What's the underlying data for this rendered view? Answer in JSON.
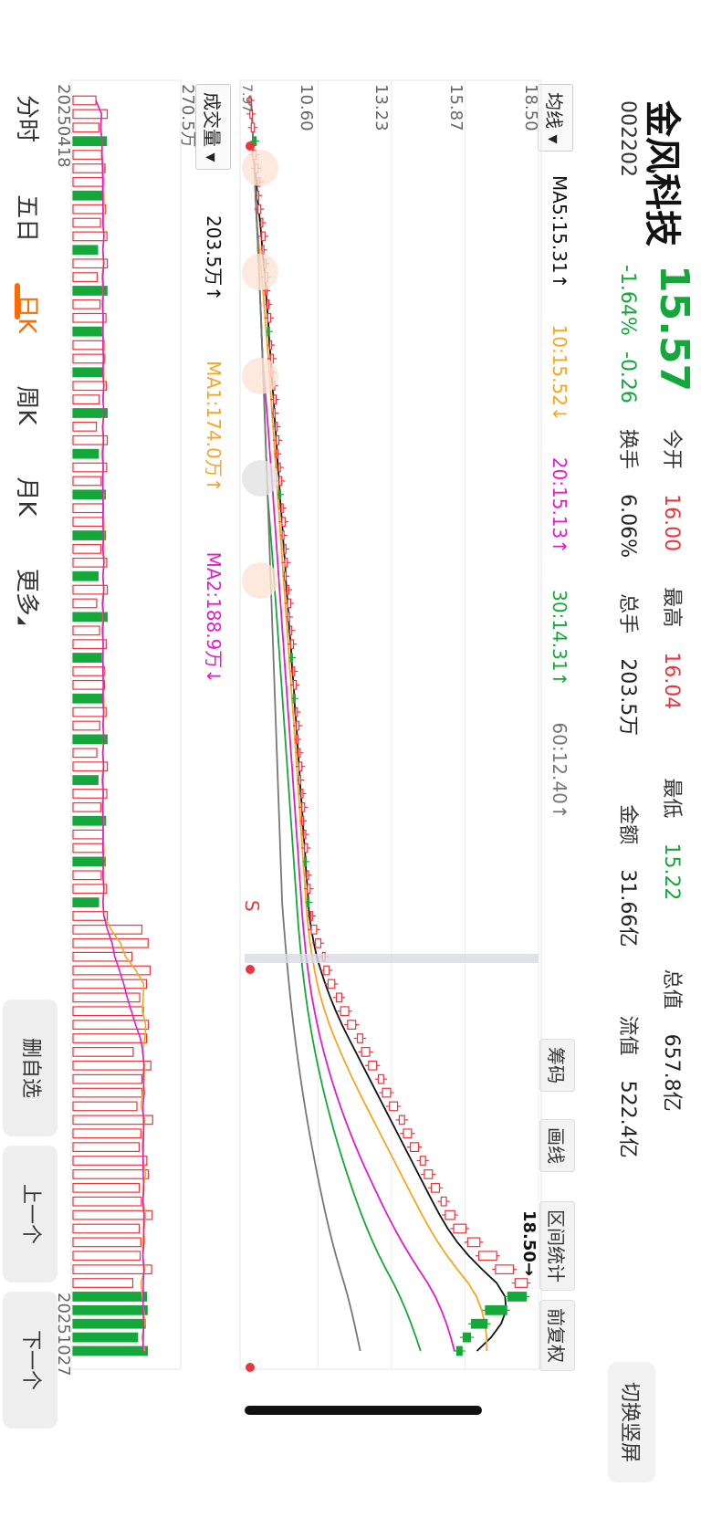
{
  "header": {
    "name": "金风科技",
    "price": "15.57",
    "code": "002202",
    "change_pct": "-1.64%",
    "change_abs": "-0.26",
    "stats": [
      {
        "label": "今开",
        "value": "16.00",
        "color": "#e8363c"
      },
      {
        "label": "最高",
        "value": "16.04",
        "color": "#e8363c"
      },
      {
        "label": "最低",
        "value": "15.22",
        "color": "#14a83a"
      },
      {
        "label": "总值",
        "value": "657.8亿",
        "color": "#222222"
      },
      {
        "label": "换手",
        "value": "6.06%",
        "color": "#222222"
      },
      {
        "label": "总手",
        "value": "203.5万",
        "color": "#222222"
      },
      {
        "label": "金额",
        "value": "31.66亿",
        "color": "#222222"
      },
      {
        "label": "流值",
        "value": "522.4亿",
        "color": "#222222"
      }
    ],
    "switch_label": "切换竖屏"
  },
  "ma_bar": {
    "selector": "均线",
    "items": [
      {
        "text": "MA5:15.31↑",
        "color": "#111111"
      },
      {
        "text": "10:15.52↓",
        "color": "#f5a623"
      },
      {
        "text": "20:15.13↑",
        "color": "#e01ec8"
      },
      {
        "text": "30:14.31↑",
        "color": "#14a83a"
      },
      {
        "text": "60:12.40↑",
        "color": "#777777"
      }
    ]
  },
  "tools": [
    "筹码",
    "画线",
    "区间统计",
    "前复权"
  ],
  "vol_bar": {
    "selector": "成交量",
    "items": [
      {
        "text": "203.5万↑",
        "color": "#111111"
      },
      {
        "text": "MA1:174.0万↑",
        "color": "#f5a623"
      },
      {
        "text": "MA2:188.9万↓",
        "color": "#e01ec8"
      }
    ]
  },
  "tabs": [
    "分时",
    "五日",
    "日K",
    "周K",
    "月K",
    "更多"
  ],
  "active_tab": "日K",
  "bottom_buttons": [
    "删自选",
    "上一个",
    "下一个"
  ],
  "markers": {
    "sell": "S",
    "max_label": "18.50→",
    "min_label": "7.97"
  },
  "chart_data": {
    "type": "candlestick",
    "price_axis": {
      "ticks": [
        "18.50",
        "15.87",
        "13.23",
        "10.60"
      ],
      "ylim": [
        7.97,
        18.5
      ]
    },
    "volume_axis": {
      "ticks": [
        "270.5万"
      ]
    },
    "x_start": "20250418",
    "x_end": "20251027",
    "max": 18.5,
    "min": 7.97,
    "series": [
      {
        "name": "MA5",
        "color": "#111111"
      },
      {
        "name": "10",
        "color": "#f5a623"
      },
      {
        "name": "20",
        "color": "#e01ec8"
      },
      {
        "name": "30",
        "color": "#14a83a"
      },
      {
        "name": "60",
        "color": "#777777"
      }
    ],
    "close": [
      8.2,
      8.25,
      8.32,
      8.3,
      8.38,
      8.45,
      8.52,
      8.48,
      8.55,
      8.62,
      8.7,
      8.66,
      8.74,
      8.8,
      8.77,
      8.84,
      8.9,
      8.86,
      8.94,
      9.0,
      8.97,
      9.05,
      9.1,
      9.06,
      9.14,
      9.2,
      9.16,
      9.25,
      9.3,
      9.26,
      9.35,
      9.42,
      9.38,
      9.45,
      9.5,
      9.46,
      9.55,
      9.62,
      9.58,
      9.66,
      9.72,
      9.68,
      9.76,
      9.82,
      9.78,
      9.86,
      9.92,
      9.88,
      9.96,
      10.02,
      9.98,
      10.06,
      10.12,
      10.08,
      10.16,
      10.22,
      10.18,
      10.26,
      10.32,
      10.28,
      10.4,
      10.55,
      10.7,
      10.85,
      11.0,
      11.2,
      11.45,
      11.7,
      11.95,
      12.2,
      12.45,
      12.7,
      12.95,
      13.2,
      13.45,
      13.7,
      13.95,
      14.2,
      14.45,
      14.7,
      14.95,
      15.2,
      15.5,
      15.9,
      16.4,
      17.0,
      17.6,
      18.1,
      17.4,
      16.6,
      16.1,
      15.8,
      15.57
    ],
    "volume_max": 270.5
  }
}
